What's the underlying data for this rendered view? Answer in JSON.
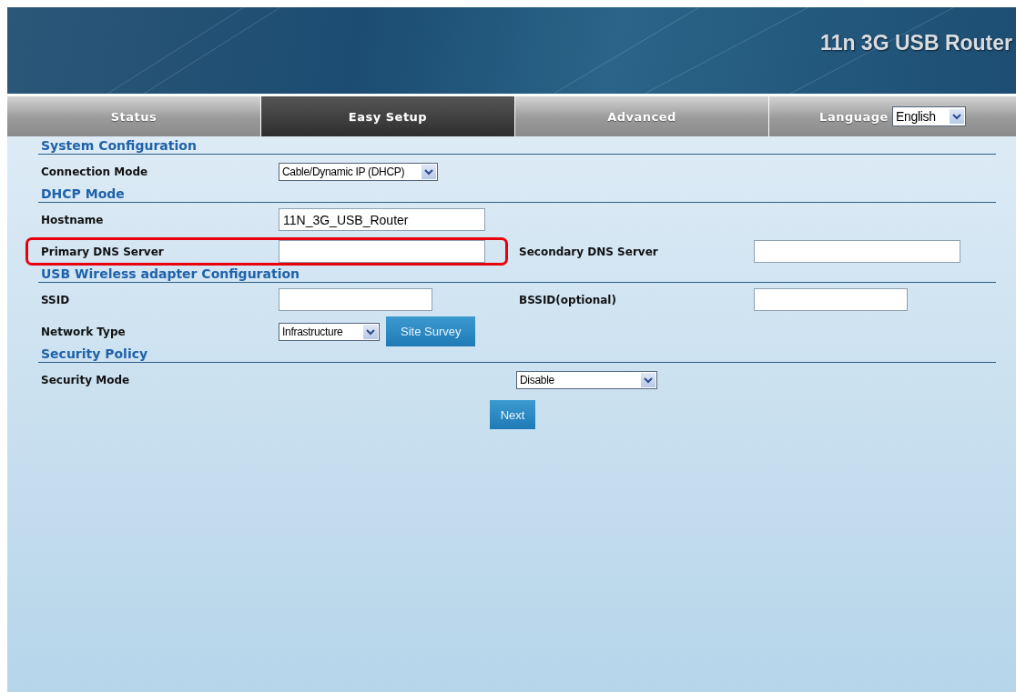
{
  "banner": {
    "title": "11n 3G USB Router"
  },
  "tabs": [
    {
      "label": "Status",
      "selected": false
    },
    {
      "label": "Easy Setup",
      "selected": true
    },
    {
      "label": "Advanced",
      "selected": false
    }
  ],
  "language": {
    "label": "Language",
    "value": "English"
  },
  "sections": [
    {
      "title": "System Configuration",
      "rows": [
        {
          "highlighted": false,
          "fields": [
            {
              "kind": "select",
              "label": "Connection Mode",
              "value": "Cable/Dynamic IP (DHCP)"
            }
          ]
        }
      ]
    },
    {
      "title": "DHCP Mode",
      "rows": [
        {
          "highlighted": false,
          "fields": [
            {
              "kind": "input",
              "label": "Hostname",
              "value": "11N_3G_USB_Router"
            }
          ]
        },
        {
          "highlighted": true,
          "fields": [
            {
              "kind": "input",
              "label": "Primary DNS Server"
            },
            {
              "kind": "input",
              "label": "Secondary DNS Server"
            }
          ]
        }
      ]
    },
    {
      "title": "USB Wireless adapter Configuration",
      "rows": [
        {
          "highlighted": false,
          "fields": [
            {
              "kind": "short_input",
              "label": "SSID"
            },
            {
              "kind": "short_input",
              "label": "BSSID(optional)"
            }
          ]
        },
        {
          "highlighted": false,
          "fields": [
            {
              "kind": "select_button",
              "label": "Network Type",
              "value": "Infrastructure",
              "button": "Site Survey"
            }
          ]
        }
      ]
    },
    {
      "title": "Security Policy",
      "rows": [
        {
          "highlighted": false,
          "fields": [
            {
              "kind": "wide_select",
              "label": "Security Mode",
              "value": "Disable"
            }
          ]
        }
      ]
    }
  ],
  "next_button": "Next"
}
